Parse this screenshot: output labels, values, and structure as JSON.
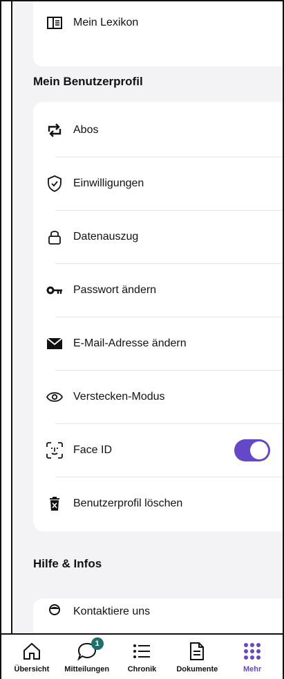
{
  "top_item": {
    "label": "Mein Lexikon",
    "icon": "book-icon"
  },
  "profile_section": {
    "title": "Mein Benutzerprofil",
    "items": [
      {
        "label": "Abos",
        "icon": "repeat-icon"
      },
      {
        "label": "Einwilligungen",
        "icon": "shield-check-icon"
      },
      {
        "label": "Datenauszug",
        "icon": "lock-icon"
      },
      {
        "label": "Passwort ändern",
        "icon": "key-icon"
      },
      {
        "label": "E-Mail-Adresse ändern",
        "icon": "envelope-icon"
      },
      {
        "label": "Verstecken-Modus",
        "icon": "eye-icon"
      },
      {
        "label": "Face ID",
        "icon": "face-id-icon",
        "toggle_on": true
      },
      {
        "label": "Benutzerprofil löschen",
        "icon": "trash-icon"
      }
    ]
  },
  "help_section": {
    "title": "Hilfe & Infos",
    "items": [
      {
        "label": "Kontaktiere uns",
        "icon": "person-icon"
      }
    ]
  },
  "tabbar": {
    "accent": "#6448c8",
    "tabs": [
      {
        "label": "Übersicht",
        "icon": "home-icon"
      },
      {
        "label": "Mitteilungen",
        "icon": "chat-bubble-icon",
        "badge": "1"
      },
      {
        "label": "Chronik",
        "icon": "list-icon"
      },
      {
        "label": "Dokumente",
        "icon": "document-icon"
      },
      {
        "label": "Mehr",
        "icon": "grid-dots-icon",
        "active": true
      }
    ]
  }
}
